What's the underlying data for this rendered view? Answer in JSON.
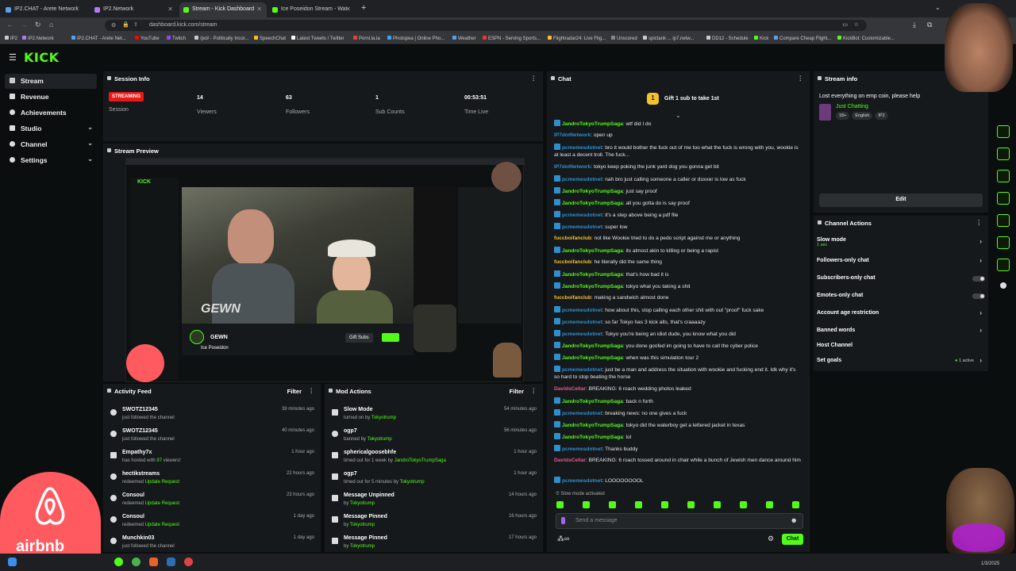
{
  "browser": {
    "tabs": [
      {
        "title": "IP2.CHAT - Arete Network",
        "color": "#5aa0e6"
      },
      {
        "title": "IP2.Network",
        "color": "#b07cf0"
      },
      {
        "title": "Stream - Kick Dashboard",
        "color": "#53fc18"
      },
      {
        "title": "Ice Poseidon Stream - Wat",
        "color": "#53fc18"
      }
    ],
    "url": "dashboard.kick.com/stream",
    "bookmarks": [
      "IP2",
      "IP2.Network",
      "IP2.CHAT - Arete Net...",
      "YouTube",
      "Twitch",
      "/pol/ - Politically Incor...",
      "SpeechChat",
      "Latest Tweets / Twitter",
      "Pornl.la.la",
      "Photopea | Online Pho...",
      "Weather",
      "ESPN - Serving Sports...",
      "Flightradar24: Live Flig...",
      "Unscored",
      "spictank ... ip7.netw...",
      "DD12 - Schedule",
      "Kick",
      "Compare Cheap Flight...",
      "KickBot: Customizable..."
    ]
  },
  "kick": {
    "logo": "KICK",
    "nav": [
      {
        "label": "Stream",
        "active": true,
        "chevron": false
      },
      {
        "label": "Revenue",
        "active": false,
        "chevron": false
      },
      {
        "label": "Achievements",
        "active": false,
        "chevron": false
      },
      {
        "label": "Studio",
        "active": false,
        "chevron": true
      },
      {
        "label": "Channel",
        "active": false,
        "chevron": true
      },
      {
        "label": "Settings",
        "active": false,
        "chevron": true
      }
    ]
  },
  "session": {
    "title": "Session Info",
    "status_badge": "STREAMING",
    "status_label": "Session",
    "stats": [
      {
        "value": "14",
        "label": "Viewers"
      },
      {
        "value": "63",
        "label": "Followers"
      },
      {
        "value": "1",
        "label": "Sub Counts"
      },
      {
        "value": "00:53:51",
        "label": "Time Live"
      }
    ]
  },
  "preview": {
    "title": "Stream Preview",
    "overlay_text": "GEWN",
    "streamer_name": "Ice Poseidon",
    "gift_label": "Gift Subs"
  },
  "activity": {
    "title": "Activity Feed",
    "filter": "Filter",
    "items": [
      {
        "name": "SWOTZ12345",
        "detail": "just followed the channel",
        "time": "39 minutes ago"
      },
      {
        "name": "SWOTZ12345",
        "detail": "just followed the channel",
        "time": "40 minutes ago"
      },
      {
        "name": "Empathy7x",
        "detail": "has hosted with ",
        "highlight": "97",
        "tail": " viewers!",
        "time": "1 hour ago"
      },
      {
        "name": "hectikstreams",
        "detail": "redeemed ",
        "highlight": "Update Request",
        "tail": "",
        "time": "22 hours ago"
      },
      {
        "name": "Consoul",
        "detail": "redeemed ",
        "highlight": "Update Request",
        "tail": "",
        "time": "23 hours ago"
      },
      {
        "name": "Consoul",
        "detail": "redeemed ",
        "highlight": "Update Request",
        "tail": "",
        "time": "1 day ago"
      },
      {
        "name": "Munchkin03",
        "detail": "just followed the channel",
        "time": "1 day ago"
      }
    ]
  },
  "mod": {
    "title": "Mod Actions",
    "filter": "Filter",
    "items": [
      {
        "name": "Slow Mode",
        "detail": "turned on by ",
        "highlight": "Tokyotrump",
        "time": "54 minutes ago"
      },
      {
        "name": "ogp7",
        "detail": "banned by ",
        "highlight": "Tokyotrump",
        "time": "56 minutes ago"
      },
      {
        "name": "sphericalgoosebhfe",
        "detail": "timed out for 1 week by ",
        "highlight": "JandroTokyoTrumpSaga",
        "time": "1 hour ago"
      },
      {
        "name": "ogp7",
        "detail": "timed out for 5 minutes by ",
        "highlight": "Tokyotrump",
        "time": "1 hour ago"
      },
      {
        "name": "Message Unpinned",
        "detail": "by ",
        "highlight": "Tokyotrump",
        "time": "14 hours ago"
      },
      {
        "name": "Message Pinned",
        "detail": "by ",
        "highlight": "Tokyotrump",
        "time": "16 hours ago"
      },
      {
        "name": "Message Pinned",
        "detail": "by ",
        "highlight": "Tokyotrump",
        "time": "17 hours ago"
      }
    ]
  },
  "chat": {
    "title": "Chat",
    "gift_banner": "Gift 1 sub to take 1st",
    "messages": [
      {
        "user": "JandroTokyoTrumpSaga",
        "color": "#53fc18",
        "text": "wtf did I do",
        "badge": true
      },
      {
        "user": "IP7dotNetwork",
        "color": "#2e8fcf",
        "text": "open up",
        "badge": false
      },
      {
        "user": "pcmemesdotnet",
        "color": "#2e8fcf",
        "text": "bro it would bother the fuck out of me too what the fuck is wrong with you, wookie is at least a decent troll. The fuck...",
        "badge": true
      },
      {
        "user": "IP7dotNetwork",
        "color": "#2e8fcf",
        "text": "tokyo keep poking the junk yard dog you gonna get bit",
        "badge": false
      },
      {
        "user": "pcmemesdotnet",
        "color": "#2e8fcf",
        "text": "nah bro just calling someone a caller or doxxer is low as fuck",
        "badge": true
      },
      {
        "user": "JandroTokyoTrumpSaga",
        "color": "#53fc18",
        "text": "just say proof",
        "badge": true
      },
      {
        "user": "JandroTokyoTrumpSaga",
        "color": "#53fc18",
        "text": "all you gotta do is say proof",
        "badge": true
      },
      {
        "user": "pcmemesdotnet",
        "color": "#2e8fcf",
        "text": "it's a step above being a pdf file",
        "badge": true
      },
      {
        "user": "pcmemesdotnet",
        "color": "#2e8fcf",
        "text": "super low",
        "badge": true
      },
      {
        "user": "fuccboifanclub",
        "color": "#f3c12c",
        "text": "not like Wookie tried to do a pedo script against me or anything",
        "badge": false
      },
      {
        "user": "JandroTokyoTrumpSaga",
        "color": "#53fc18",
        "text": "its almost akin to killing or being a rapist",
        "badge": true
      },
      {
        "user": "fuccboifanclub",
        "color": "#f3c12c",
        "text": "he literally did the same thing",
        "badge": false
      },
      {
        "user": "JandroTokyoTrumpSaga",
        "color": "#53fc18",
        "text": "that's how bad it is",
        "badge": true
      },
      {
        "user": "JandroTokyoTrumpSaga",
        "color": "#53fc18",
        "text": "tokyo what you taking a shit",
        "badge": true
      },
      {
        "user": "fuccboifanclub",
        "color": "#f3c12c",
        "text": "making a sandwich almost done",
        "badge": false
      },
      {
        "user": "pcmemesdotnet",
        "color": "#2e8fcf",
        "text": "how about this, stop calling each other shit with out \"proof\" fuck sake",
        "badge": true
      },
      {
        "user": "pcmemesdotnet",
        "color": "#2e8fcf",
        "text": "so far Tokyo has 3 kick alts, that's craaaazy",
        "badge": true
      },
      {
        "user": "pcmemesdotnet",
        "color": "#2e8fcf",
        "text": "Tokyo you're being an idiot dude, you know what you did",
        "badge": true
      },
      {
        "user": "JandroTokyoTrumpSaga",
        "color": "#53fc18",
        "text": "you done goofed im going to have to call the cyber police",
        "badge": true
      },
      {
        "user": "JandroTokyoTrumpSaga",
        "color": "#53fc18",
        "text": "when was this simulation tour 2",
        "badge": true
      },
      {
        "user": "pcmemesdotnet",
        "color": "#2e8fcf",
        "text": "just be a man and address the situation with wookie and fucking end it. Idk why it's so hard to stop beating the horse",
        "badge": true
      },
      {
        "user": "DavidsCellar",
        "color": "#e85a8a",
        "text": "BREAKING: 6 roach wedding photos leaked",
        "badge": false
      },
      {
        "user": "JandroTokyoTrumpSaga",
        "color": "#53fc18",
        "text": "back n forth",
        "badge": true
      },
      {
        "user": "pcmemesdotnet",
        "color": "#2e8fcf",
        "text": "breaking news: no one gives a fuck",
        "badge": true
      },
      {
        "user": "JandroTokyoTrumpSaga",
        "color": "#53fc18",
        "text": "tokyo did the waterboy get a lettered jacket in texas",
        "badge": true
      },
      {
        "user": "JandroTokyoTrumpSaga",
        "color": "#53fc18",
        "text": "lol",
        "badge": true
      },
      {
        "user": "pcmemesdotnet",
        "color": "#2e8fcf",
        "text": "Thanks buddy",
        "badge": true
      },
      {
        "user": "DavidsCellar",
        "color": "#e85a8a",
        "text": "BREAKING: 6 roach tossed around in chair while a bunch of Jewish men dance around him",
        "badge": false
      },
      {
        "user": "pcmemesdotnet",
        "color": "#2e8fcf",
        "text": "LOOOOOOOOL",
        "badge": true
      }
    ],
    "slow_mode_notice": "Slow mode activated",
    "input_placeholder": "Send a message",
    "send_label": "Chat"
  },
  "streaminfo": {
    "title": "Stream info",
    "stream_title": "Lost everything on emp coin, please help",
    "category": "Just Chatting",
    "tags": [
      "18+",
      "English",
      "IP2"
    ],
    "edit_label": "Edit"
  },
  "channel_actions": {
    "title": "Channel Actions",
    "items": [
      {
        "label": "Slow mode",
        "sub": "1 sec",
        "control": "chevron"
      },
      {
        "label": "Followers-only chat",
        "sub": "",
        "control": "chevron"
      },
      {
        "label": "Subscribers-only chat",
        "sub": "",
        "control": "toggle"
      },
      {
        "label": "Emotes-only chat",
        "sub": "",
        "control": "toggle"
      },
      {
        "label": "Account age restriction",
        "sub": "",
        "control": "chevron"
      },
      {
        "label": "Banned words",
        "sub": "",
        "control": "chevron"
      },
      {
        "label": "Host Channel",
        "sub": "",
        "control": "none"
      },
      {
        "label": "Set goals",
        "sub": "",
        "control": "chevron",
        "status": "1 active"
      }
    ]
  },
  "overlay": {
    "airbnb_word": "airbnb"
  },
  "taskbar": {
    "date": "1/3/2025"
  }
}
